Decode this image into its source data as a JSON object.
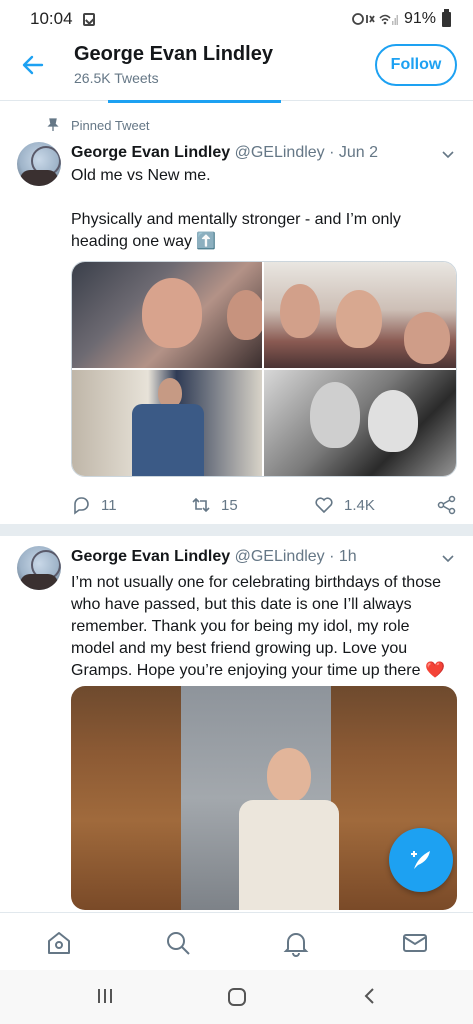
{
  "status_bar": {
    "time": "10:04",
    "battery": "91%"
  },
  "header": {
    "name": "George Evan Lindley",
    "tweet_count": "26.5K Tweets",
    "follow_label": "Follow"
  },
  "tweets": [
    {
      "pinned_label": "Pinned Tweet",
      "name": "George Evan Lindley",
      "meta": "@GELindley · Jun 2",
      "text": "Old me vs New me.\n\nPhysically and mentally stronger - and I’m only heading one way ⬆️",
      "replies": "11",
      "retweets": "15",
      "likes": "1.4K"
    },
    {
      "name": "George Evan Lindley",
      "meta": "@GELindley · 1h",
      "text": "I’m not usually one for celebrating birthdays of those who have passed, but this date is one I’ll always remember. Thank you for being my idol, my role model and my best friend growing up. Love you Gramps. Hope you’re enjoying your time up there ❤️"
    }
  ],
  "colors": {
    "accent": "#1da1f2",
    "secondary_text": "#657786",
    "divider": "#e6ecf0"
  },
  "icons": [
    "back-arrow-icon",
    "pin-icon",
    "chevron-down-icon",
    "reply-icon",
    "retweet-icon",
    "heart-icon",
    "share-icon",
    "compose-icon",
    "home-icon",
    "search-icon",
    "bell-icon",
    "mail-icon"
  ]
}
